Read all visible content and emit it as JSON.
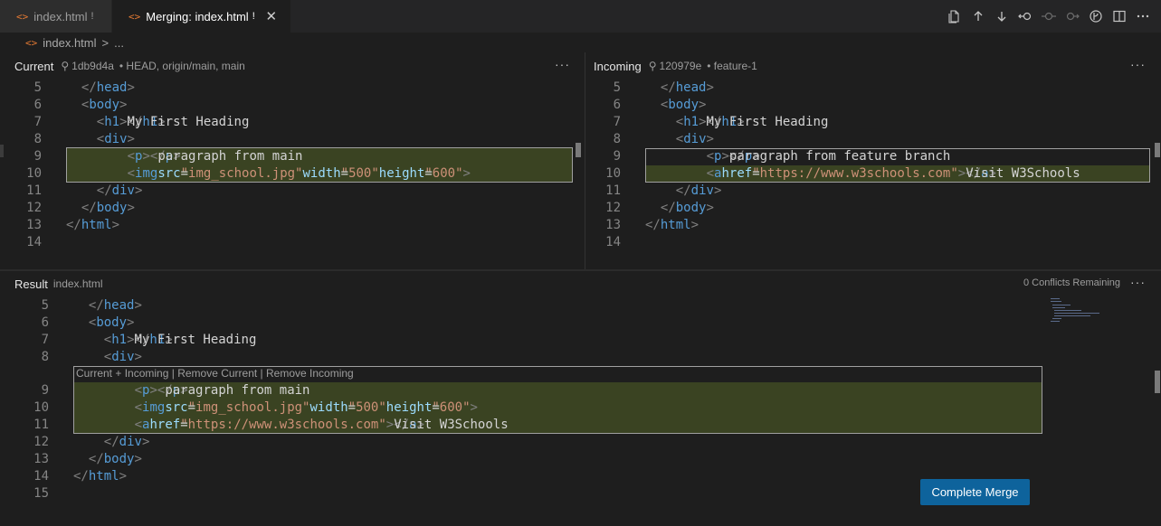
{
  "tabs": [
    {
      "label": "index.html",
      "dirty": "!",
      "icon": "code-brackets-icon"
    },
    {
      "label": "Merging: index.html",
      "dirty": "!",
      "icon": "code-brackets-icon",
      "close": "✕"
    }
  ],
  "toolbar_icons": [
    "open-file-icon",
    "arrow-up-icon",
    "arrow-down-icon",
    "accept-current-icon",
    "accept-both-icon",
    "accept-incoming-icon",
    "source-control-icon",
    "split-editor-icon",
    "more-actions-icon"
  ],
  "breadcrumb": {
    "file": "index.html",
    "separator": ">",
    "more": "..."
  },
  "current": {
    "title": "Current",
    "commit": "1db9d4a",
    "refs": "• HEAD, origin/main, main",
    "more": "···"
  },
  "incoming": {
    "title": "Incoming",
    "commit": "120979e",
    "refs": "• feature-1",
    "more": "···"
  },
  "result": {
    "title": "Result",
    "file": "index.html",
    "conflicts": "0 Conflicts Remaining",
    "more": "···",
    "codelens": {
      "a": "Current + Incoming",
      "b": "Remove Current",
      "c": "Remove Incoming",
      "sep": " | "
    },
    "button": "Complete Merge"
  },
  "code": {
    "current_lines": [
      {
        "n": "5",
        "parts": [
          [
            "brk",
            "</"
          ],
          [
            "tag",
            "head"
          ],
          [
            "brk",
            ">"
          ]
        ],
        "indent": 1
      },
      {
        "n": "6",
        "parts": [
          [
            "brk",
            "<"
          ],
          [
            "tag",
            "body"
          ],
          [
            "brk",
            ">"
          ]
        ],
        "indent": 1
      },
      {
        "n": "7",
        "parts": [
          [
            "brk",
            "<"
          ],
          [
            "tag",
            "h1"
          ],
          [
            "brk",
            ">"
          ],
          [
            "txt",
            "My First Heading"
          ],
          [
            "brk",
            "</"
          ],
          [
            "tag",
            "h1"
          ],
          [
            "brk",
            ">"
          ]
        ],
        "indent": 2
      },
      {
        "n": "8",
        "parts": [
          [
            "brk",
            "<"
          ],
          [
            "tag",
            "div"
          ],
          [
            "brk",
            ">"
          ]
        ],
        "indent": 2
      },
      {
        "n": "9",
        "parts": [
          [
            "brk",
            "<"
          ],
          [
            "tag",
            "p"
          ],
          [
            "brk",
            ">"
          ],
          [
            "txt",
            " paragraph from main "
          ],
          [
            "brk",
            "</"
          ],
          [
            "tag",
            "p"
          ],
          [
            "brk",
            ">"
          ]
        ],
        "indent": 4
      },
      {
        "n": "10",
        "parts": [
          [
            "brk",
            "<"
          ],
          [
            "tag",
            "img"
          ],
          [
            "txt",
            " "
          ],
          [
            "attr",
            "src"
          ],
          [
            "txt",
            "="
          ],
          [
            "str",
            "\"img_school.jpg\""
          ],
          [
            "txt",
            " "
          ],
          [
            "attr",
            "width"
          ],
          [
            "txt",
            "="
          ],
          [
            "str",
            "\"500\""
          ],
          [
            "txt",
            " "
          ],
          [
            "attr",
            "height"
          ],
          [
            "txt",
            "="
          ],
          [
            "str",
            "\"600\""
          ],
          [
            "brk",
            ">"
          ]
        ],
        "indent": 4
      },
      {
        "n": "11",
        "parts": [
          [
            "brk",
            "</"
          ],
          [
            "tag",
            "div"
          ],
          [
            "brk",
            ">"
          ]
        ],
        "indent": 2
      },
      {
        "n": "12",
        "parts": [
          [
            "brk",
            "</"
          ],
          [
            "tag",
            "body"
          ],
          [
            "brk",
            ">"
          ]
        ],
        "indent": 1
      },
      {
        "n": "13",
        "parts": [
          [
            "brk",
            "</"
          ],
          [
            "tag",
            "html"
          ],
          [
            "brk",
            ">"
          ]
        ],
        "indent": 0
      },
      {
        "n": "14",
        "parts": [],
        "indent": 0
      }
    ],
    "incoming_lines": [
      {
        "n": "5",
        "parts": [
          [
            "brk",
            "</"
          ],
          [
            "tag",
            "head"
          ],
          [
            "brk",
            ">"
          ]
        ],
        "indent": 1
      },
      {
        "n": "6",
        "parts": [
          [
            "brk",
            "<"
          ],
          [
            "tag",
            "body"
          ],
          [
            "brk",
            ">"
          ]
        ],
        "indent": 1
      },
      {
        "n": "7",
        "parts": [
          [
            "brk",
            "<"
          ],
          [
            "tag",
            "h1"
          ],
          [
            "brk",
            ">"
          ],
          [
            "txt",
            "My First Heading"
          ],
          [
            "brk",
            "</"
          ],
          [
            "tag",
            "h1"
          ],
          [
            "brk",
            ">"
          ]
        ],
        "indent": 2
      },
      {
        "n": "8",
        "parts": [
          [
            "brk",
            "<"
          ],
          [
            "tag",
            "div"
          ],
          [
            "brk",
            ">"
          ]
        ],
        "indent": 2
      },
      {
        "n": "9",
        "parts": [
          [
            "brk",
            "<"
          ],
          [
            "tag",
            "p"
          ],
          [
            "brk",
            ">"
          ],
          [
            "txt",
            "paragraph from feature branch"
          ],
          [
            "brk",
            "</"
          ],
          [
            "tag",
            "p"
          ],
          [
            "brk",
            ">"
          ]
        ],
        "indent": 4
      },
      {
        "n": "10",
        "parts": [
          [
            "brk",
            "<"
          ],
          [
            "tag",
            "a"
          ],
          [
            "txt",
            " "
          ],
          [
            "attr",
            "href"
          ],
          [
            "txt",
            "="
          ],
          [
            "str",
            "\"https://www.w3schools.com\""
          ],
          [
            "brk",
            ">"
          ],
          [
            "txt",
            "Visit W3Schools"
          ],
          [
            "brk",
            "</"
          ],
          [
            "tag",
            "a"
          ],
          [
            "brk",
            ">"
          ]
        ],
        "indent": 4
      },
      {
        "n": "11",
        "parts": [
          [
            "brk",
            "</"
          ],
          [
            "tag",
            "div"
          ],
          [
            "brk",
            ">"
          ]
        ],
        "indent": 2
      },
      {
        "n": "12",
        "parts": [
          [
            "brk",
            "</"
          ],
          [
            "tag",
            "body"
          ],
          [
            "brk",
            ">"
          ]
        ],
        "indent": 1
      },
      {
        "n": "13",
        "parts": [
          [
            "brk",
            "</"
          ],
          [
            "tag",
            "html"
          ],
          [
            "brk",
            ">"
          ]
        ],
        "indent": 0
      },
      {
        "n": "14",
        "parts": [],
        "indent": 0
      }
    ],
    "result_lines": [
      {
        "n": "5",
        "parts": [
          [
            "brk",
            "</"
          ],
          [
            "tag",
            "head"
          ],
          [
            "brk",
            ">"
          ]
        ],
        "indent": 1
      },
      {
        "n": "6",
        "parts": [
          [
            "brk",
            "<"
          ],
          [
            "tag",
            "body"
          ],
          [
            "brk",
            ">"
          ]
        ],
        "indent": 1
      },
      {
        "n": "7",
        "parts": [
          [
            "brk",
            "<"
          ],
          [
            "tag",
            "h1"
          ],
          [
            "brk",
            ">"
          ],
          [
            "txt",
            "My First Heading"
          ],
          [
            "brk",
            "</"
          ],
          [
            "tag",
            "h1"
          ],
          [
            "brk",
            ">"
          ]
        ],
        "indent": 2
      },
      {
        "n": "8",
        "parts": [
          [
            "brk",
            "<"
          ],
          [
            "tag",
            "div"
          ],
          [
            "brk",
            ">"
          ]
        ],
        "indent": 2
      },
      {
        "n": "9",
        "parts": [
          [
            "brk",
            "<"
          ],
          [
            "tag",
            "p"
          ],
          [
            "brk",
            ">"
          ],
          [
            "txt",
            " paragraph from main "
          ],
          [
            "brk",
            "</"
          ],
          [
            "tag",
            "p"
          ],
          [
            "brk",
            ">"
          ]
        ],
        "indent": 4
      },
      {
        "n": "10",
        "parts": [
          [
            "brk",
            "<"
          ],
          [
            "tag",
            "img"
          ],
          [
            "txt",
            " "
          ],
          [
            "attr",
            "src"
          ],
          [
            "txt",
            "="
          ],
          [
            "str",
            "\"img_school.jpg\""
          ],
          [
            "txt",
            " "
          ],
          [
            "attr",
            "width"
          ],
          [
            "txt",
            "="
          ],
          [
            "str",
            "\"500\""
          ],
          [
            "txt",
            " "
          ],
          [
            "attr",
            "height"
          ],
          [
            "txt",
            "="
          ],
          [
            "str",
            "\"600\""
          ],
          [
            "brk",
            ">"
          ]
        ],
        "indent": 4
      },
      {
        "n": "11",
        "parts": [
          [
            "brk",
            "<"
          ],
          [
            "tag",
            "a"
          ],
          [
            "txt",
            " "
          ],
          [
            "attr",
            "href"
          ],
          [
            "txt",
            "="
          ],
          [
            "str",
            "\"https://www.w3schools.com\""
          ],
          [
            "brk",
            ">"
          ],
          [
            "txt",
            "Visit W3Schools"
          ],
          [
            "brk",
            "</"
          ],
          [
            "tag",
            "a"
          ],
          [
            "brk",
            ">"
          ]
        ],
        "indent": 4
      },
      {
        "n": "12",
        "parts": [
          [
            "brk",
            "</"
          ],
          [
            "tag",
            "div"
          ],
          [
            "brk",
            ">"
          ]
        ],
        "indent": 2
      },
      {
        "n": "13",
        "parts": [
          [
            "brk",
            "</"
          ],
          [
            "tag",
            "body"
          ],
          [
            "brk",
            ">"
          ]
        ],
        "indent": 1
      },
      {
        "n": "14",
        "parts": [
          [
            "brk",
            "</"
          ],
          [
            "tag",
            "html"
          ],
          [
            "brk",
            ">"
          ]
        ],
        "indent": 0
      },
      {
        "n": "15",
        "parts": [],
        "indent": 0
      }
    ]
  },
  "colors": {
    "accent": "#0e639c",
    "conflict_highlight": "#3a4322",
    "tag": "#569cd6",
    "attribute": "#9cdcfe",
    "string": "#ce9178"
  }
}
